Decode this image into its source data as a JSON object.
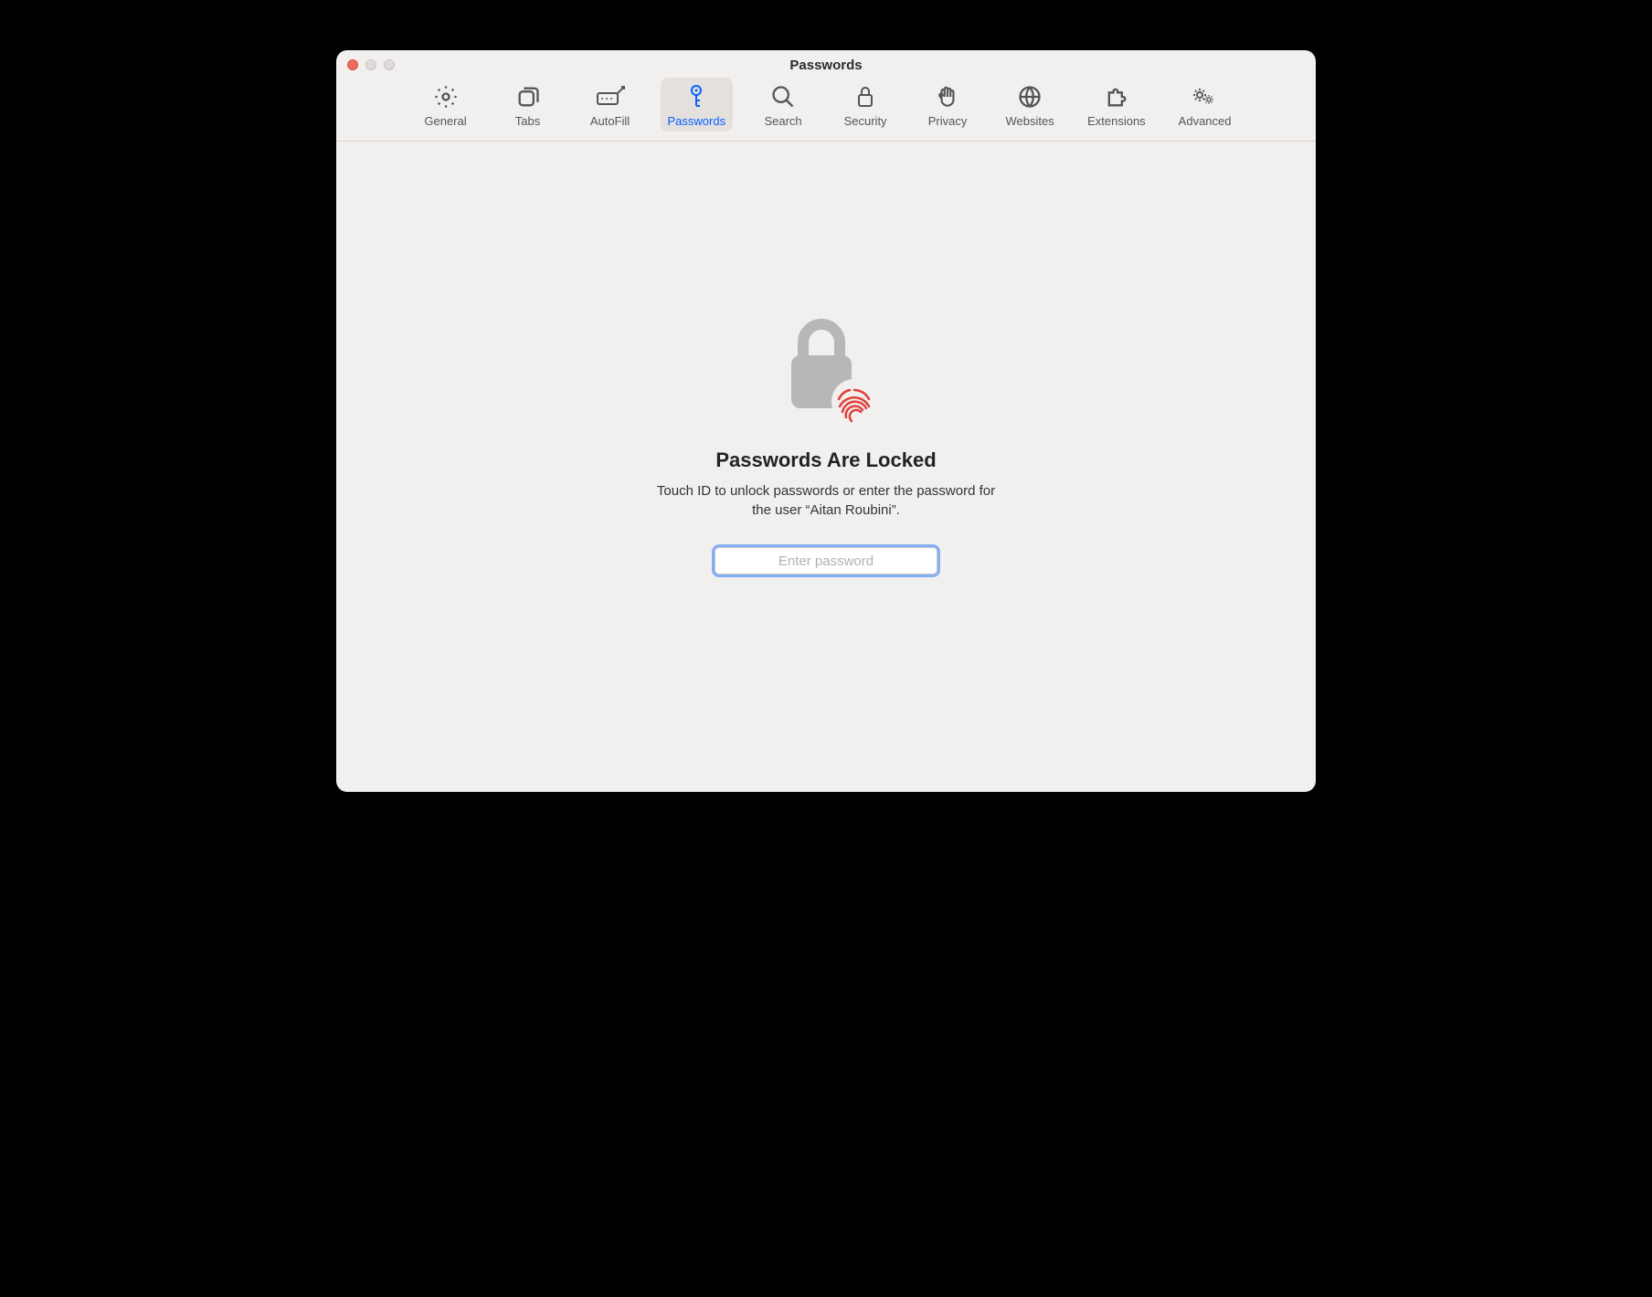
{
  "window": {
    "title": "Passwords"
  },
  "toolbar": {
    "general": "General",
    "tabs": "Tabs",
    "autofill": "AutoFill",
    "passwords": "Passwords",
    "search": "Search",
    "security": "Security",
    "privacy": "Privacy",
    "websites": "Websites",
    "extensions": "Extensions",
    "advanced": "Advanced"
  },
  "lock": {
    "heading": "Passwords Are Locked",
    "subtext": "Touch ID to unlock passwords or enter the password for the user “Aitan Roubini”.",
    "placeholder": "Enter password"
  }
}
